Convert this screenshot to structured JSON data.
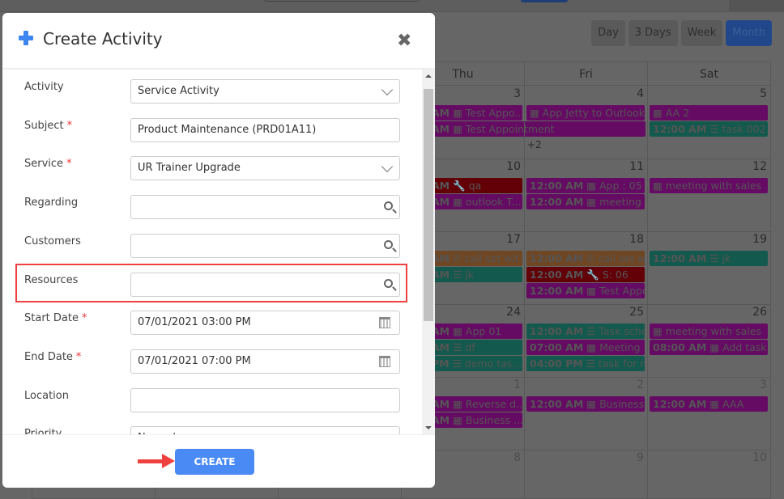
{
  "calendar": {
    "views": [
      {
        "label": "Day"
      },
      {
        "label": "3 Days"
      },
      {
        "label": "Week"
      },
      {
        "label": "Month",
        "active": true
      }
    ],
    "headers": [
      "Thu",
      "Fri",
      "Sat"
    ],
    "weeks": [
      {
        "days": [
          {
            "date": "3",
            "events": [
              {
                "time": "AM",
                "icon": "calendar",
                "title": "Test Appo...",
                "type": "appt"
              },
              {
                "time": "AM",
                "icon": "calendar",
                "title": "Test Appointment",
                "type": "appt",
                "span": 2
              }
            ]
          },
          {
            "date": "4",
            "events": [
              {
                "time": "",
                "icon": "calendar",
                "title": "App Jetty to Outlook",
                "type": "appt"
              },
              null
            ],
            "more": "+2"
          },
          {
            "date": "5",
            "events": [
              {
                "time": "",
                "icon": "calendar",
                "title": "AA 2",
                "type": "appt"
              },
              {
                "time": "12:00 AM",
                "icon": "task",
                "title": "task 002",
                "type": "task"
              }
            ]
          }
        ]
      },
      {
        "days": [
          {
            "date": "10",
            "events": [
              {
                "time": "AM",
                "icon": "wrench",
                "title": "qa",
                "type": "svc"
              },
              {
                "time": "AM",
                "icon": "calendar",
                "title": "outlook T...",
                "type": "appt"
              }
            ]
          },
          {
            "date": "11",
            "events": [
              {
                "time": "12:00 AM",
                "icon": "calendar",
                "title": "App : 05",
                "type": "appt"
              },
              {
                "time": "12:00 AM",
                "icon": "calendar",
                "title": "meeting ...",
                "type": "appt"
              }
            ]
          },
          {
            "date": "12",
            "events": [
              {
                "time": "",
                "icon": "calendar",
                "title": "meeting with sales",
                "type": "appt"
              }
            ]
          }
        ]
      },
      {
        "days": [
          {
            "date": "17",
            "events": [
              {
                "time": "AM",
                "icon": "phone",
                "title": "call set wit...",
                "type": "call"
              },
              {
                "time": "AM",
                "icon": "task",
                "title": "jk",
                "type": "task"
              }
            ]
          },
          {
            "date": "18",
            "events": [
              {
                "time": "12:00 AM",
                "icon": "phone",
                "title": "call set wit...",
                "type": "call"
              },
              {
                "time": "12:00 AM",
                "icon": "wrench",
                "title": "S: 06",
                "type": "svc"
              },
              {
                "time": "12:00 AM",
                "icon": "calendar",
                "title": "Test Appo...",
                "type": "appt"
              }
            ]
          },
          {
            "date": "19",
            "events": [
              {
                "time": "12:00 AM",
                "icon": "task",
                "title": "jk",
                "type": "task"
              }
            ]
          }
        ]
      },
      {
        "days": [
          {
            "date": "24",
            "events": [
              {
                "time": "AM",
                "icon": "calendar",
                "title": "App 01",
                "type": "appt"
              },
              {
                "time": "AM",
                "icon": "task",
                "title": "df",
                "type": "task"
              },
              {
                "time": "PM",
                "icon": "task",
                "title": "demo tas...",
                "type": "task"
              }
            ]
          },
          {
            "date": "25",
            "events": [
              {
                "time": "12:00 AM",
                "icon": "task",
                "title": "Task sche...",
                "type": "task"
              },
              {
                "time": "07:00 AM",
                "icon": "calendar",
                "title": "Meeting ...",
                "type": "appt"
              },
              {
                "time": "04:00 PM",
                "icon": "task",
                "title": "task for n...",
                "type": "task"
              }
            ]
          },
          {
            "date": "26",
            "events": [
              {
                "time": "",
                "icon": "calendar",
                "title": "meeting with sales",
                "type": "appt"
              },
              {
                "time": "08:00 AM",
                "icon": "calendar",
                "title": "Add task",
                "type": "appt"
              }
            ]
          }
        ]
      },
      {
        "days": [
          {
            "date": "1",
            "other": true,
            "events": [
              {
                "time": "AM",
                "icon": "calendar",
                "title": "Reverse d...",
                "type": "appt"
              },
              {
                "time": "AM",
                "icon": "calendar",
                "title": "Business ...",
                "type": "appt"
              }
            ]
          },
          {
            "date": "2",
            "other": true,
            "events": [
              {
                "time": "12:00 AM",
                "icon": "calendar",
                "title": "Business ...",
                "type": "appt"
              }
            ]
          },
          {
            "date": "3",
            "other": true,
            "events": [
              {
                "time": "12:00 AM",
                "icon": "calendar",
                "title": "AAA",
                "type": "appt"
              }
            ]
          }
        ]
      },
      {
        "days": [
          {
            "date": "8",
            "other": true,
            "events": []
          },
          {
            "date": "9",
            "other": true,
            "events": []
          },
          {
            "date": "10",
            "other": true,
            "events": []
          }
        ]
      }
    ]
  },
  "modal": {
    "title": "Create Activity",
    "close_icon": "close-icon",
    "fields": [
      {
        "label": "Activity",
        "value": "Service Activity",
        "kind": "select",
        "required": false
      },
      {
        "label": "Subject",
        "value": "Product Maintenance (PRD01A11)",
        "kind": "text",
        "required": true
      },
      {
        "label": "Service",
        "value": "UR Trainer Upgrade",
        "kind": "select",
        "required": true
      },
      {
        "label": "Regarding",
        "value": "",
        "kind": "lookup",
        "required": false
      },
      {
        "label": "Customers",
        "value": "",
        "kind": "lookup",
        "required": false
      },
      {
        "label": "Resources",
        "value": "",
        "kind": "lookup",
        "required": false,
        "highlighted": true
      },
      {
        "label": "Start Date",
        "value": "07/01/2021 03:00 PM",
        "kind": "date",
        "required": true
      },
      {
        "label": "End Date",
        "value": "07/01/2021 07:00 PM",
        "kind": "date",
        "required": true
      },
      {
        "label": "Location",
        "value": "",
        "kind": "text",
        "required": false
      },
      {
        "label": "Priority",
        "value": "Normal",
        "kind": "select",
        "required": false
      }
    ],
    "required_mark": "*",
    "create_label": "CREATE"
  },
  "colors": {
    "accent": "#4a8af4",
    "highlight": "#f04040",
    "appointment": "#650b63",
    "task": "#14594d",
    "call": "#6f4724",
    "service": "#630007"
  }
}
